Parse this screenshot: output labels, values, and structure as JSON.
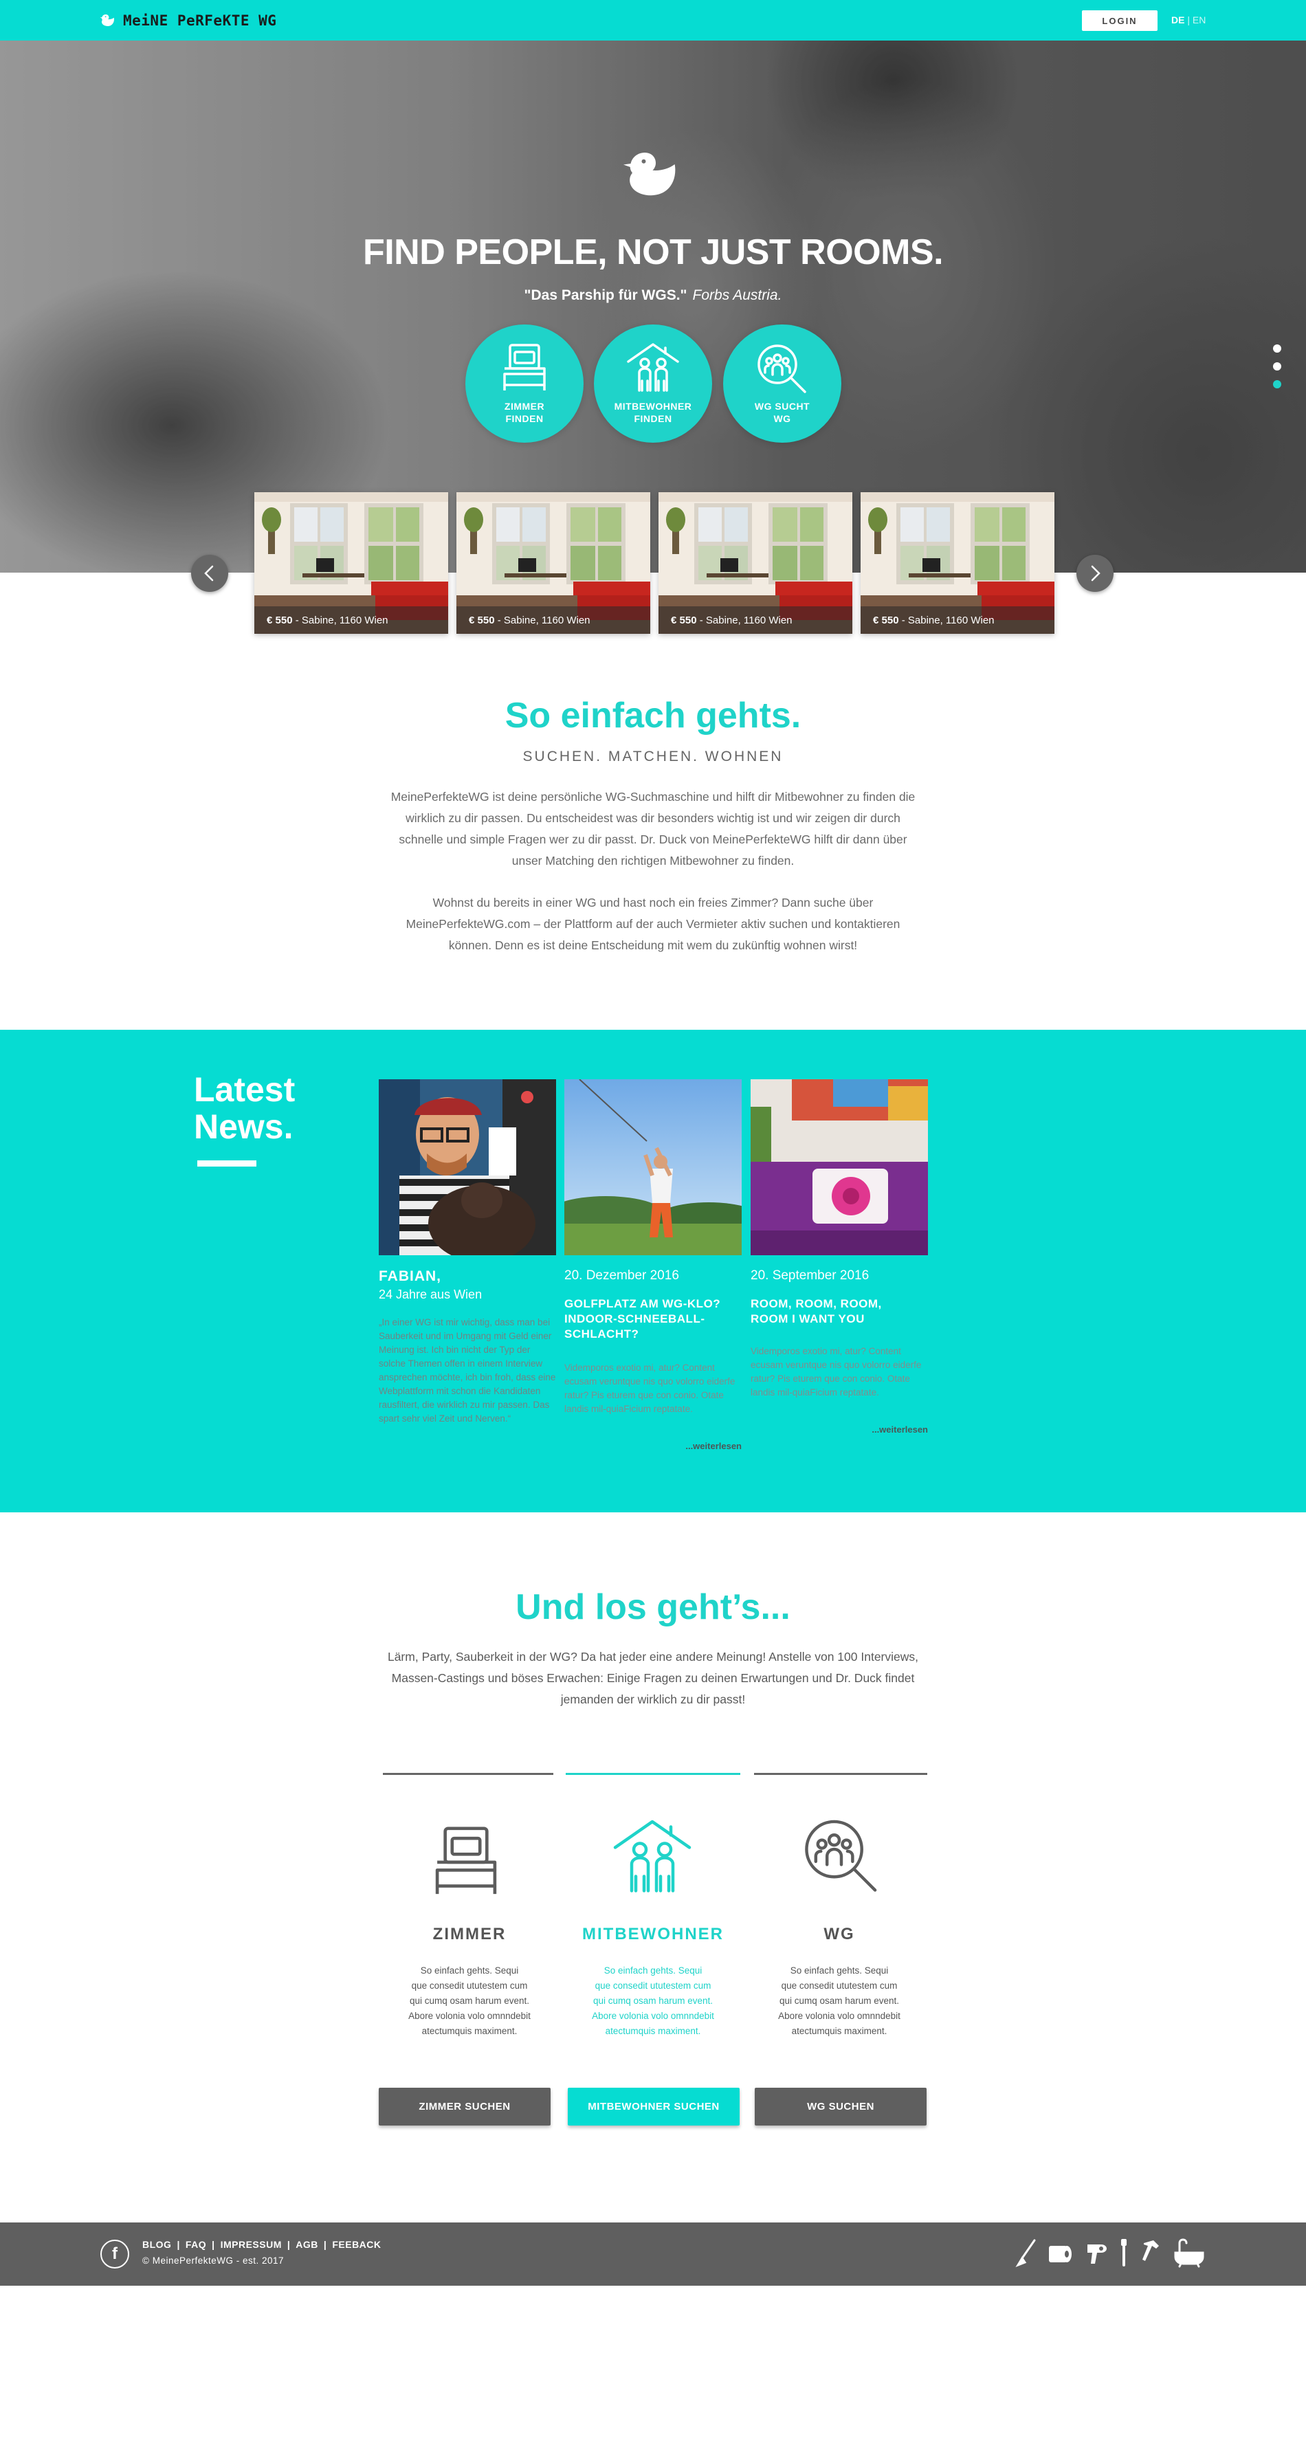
{
  "brand": {
    "logo_text": "MeiNE PeRFeKTE WG",
    "accent": "#06dcd2",
    "accent_alt": "#1fd3c9",
    "dark": "#5f5f5f"
  },
  "header": {
    "login_label": "LOGIN",
    "lang_active": "DE",
    "lang_sep": "|",
    "lang_other": "EN"
  },
  "hero": {
    "title": "FIND PEOPLE, NOT JUST ROOMS.",
    "quote": "\"Das Parship für WGS.\"",
    "quote_source": "Forbs Austria.",
    "buttons": [
      {
        "label": "ZIMMER\nFINDEN",
        "icon": "bed-icon"
      },
      {
        "label": "MITBEWOHNER\nFINDEN",
        "icon": "roommates-house-icon"
      },
      {
        "label": "WG SUCHT\nWG",
        "icon": "group-search-icon"
      }
    ],
    "slide_dots": {
      "count": 3,
      "active": 2
    }
  },
  "listings": [
    {
      "price": "€ 550",
      "details": " - Sabine, 1160 Wien"
    },
    {
      "price": "€ 550",
      "details": " - Sabine, 1160 Wien"
    },
    {
      "price": "€ 550",
      "details": " - Sabine, 1160 Wien"
    },
    {
      "price": "€ 550",
      "details": " - Sabine, 1160 Wien"
    }
  ],
  "einfach": {
    "title": "So einfach gehts.",
    "subtitle": "SUCHEN. MATCHEN. WOHNEN",
    "paragraph1": "MeinePerfekteWG ist deine persönliche WG-Suchmaschine und hilft dir Mitbewohner zu finden die wirklich zu dir passen. Du entscheidest was dir besonders wichtig ist und wir zeigen dir durch schnelle und simple Fragen wer zu dir passt. Dr. Duck von MeinePerfekteWG hilft dir dann über unser Matching den richtigen Mitbewohner zu finden.",
    "paragraph2": "Wohnst du bereits in einer WG und hast noch ein freies Zimmer? Dann suche über MeinePerfekteWG.com – der Plattform auf der auch Vermieter aktiv suchen und kontaktieren können. Denn es ist deine Entscheidung mit wem du zukünftig wohnen wirst!"
  },
  "news": {
    "heading": "Latest\nNews.",
    "cards": [
      {
        "name": "FABIAN,",
        "subtitle": "24 Jahre aus Wien",
        "body": "„In einer WG ist mir wichtig, dass man bei Sauberkeit und im Umgang mit Geld einer Meinung ist. Ich bin nicht der Typ der solche Themen offen in einem Interview ansprechen möchte, ich bin froh, dass eine Webplattform mit schon die Kandidaten rausfiltert, die wirklich zu mir passen. Das spart sehr viel Zeit und Nerven.“"
      },
      {
        "date": "20. Dezember 2016",
        "headline": "GOLFPLATZ AM WG-KLO?\nINDOOR-SCHNEEBALL-\nSCHLACHT?",
        "body": "Videmporos exotio mi, atur? Content ecusam veruntque nis quo volorro eiderfe ratur? Pis eturem que con conio. Otate landis mil-quiaFicium reptatate.",
        "more": "...weiterlesen"
      },
      {
        "date": "20. September 2016",
        "headline": "ROOM, ROOM, ROOM,\nROOM I WANT YOU",
        "body": "Videmporos exotio mi, atur? Content ecusam veruntque nis quo volorro eiderfe ratur? Pis eturem que con conio. Otate landis mil-quiaFicium reptatate.",
        "more": "...weiterlesen"
      }
    ]
  },
  "los": {
    "title": "Und los geht’s...",
    "intro": "Lärm, Party, Sauberkeit in der WG? Da hat jeder eine andere Meinung! Anstelle von 100 Interviews, Massen-Castings und böses Erwachen: Einige Fragen zu deinen Erwartungen und Dr. Duck findet jemanden der wirklich zu dir passt!",
    "features": [
      {
        "title": "ZIMMER",
        "icon": "bed-icon",
        "body": "So einfach gehts. Sequi\nque consedit ututestem cum\nqui cumq osam harum event.\nAbore volonia volo omnndebit\natectumquis maximent.",
        "cta": "ZIMMER SUCHEN",
        "active": false
      },
      {
        "title": "MITBEWOHNER",
        "icon": "roommates-house-icon",
        "body": "So einfach gehts. Sequi\nque consedit ututestem cum\nqui cumq osam harum event.\nAbore volonia volo omnndebit\natectumquis maximent.",
        "cta": "MITBEWOHNER SUCHEN",
        "active": true
      },
      {
        "title": "WG",
        "icon": "group-search-icon",
        "body": "So einfach gehts. Sequi\nque consedit ututestem cum\nqui cumq osam harum event.\nAbore volonia volo omnndebit\natectumquis maximent.",
        "cta": "WG SUCHEN",
        "active": false
      }
    ]
  },
  "footer": {
    "links": [
      "BLOG",
      "FAQ",
      "IMPRESSUM",
      "AGB",
      "FEEBACK"
    ],
    "link_sep": "|",
    "copyright": "© MeinePerfekteWG - est. 2017",
    "icons": [
      "brush-icon",
      "toilet-paper-icon",
      "hair-dryer-icon",
      "toothbrush-icon",
      "hammer-icon",
      "bathtub-icon"
    ]
  }
}
